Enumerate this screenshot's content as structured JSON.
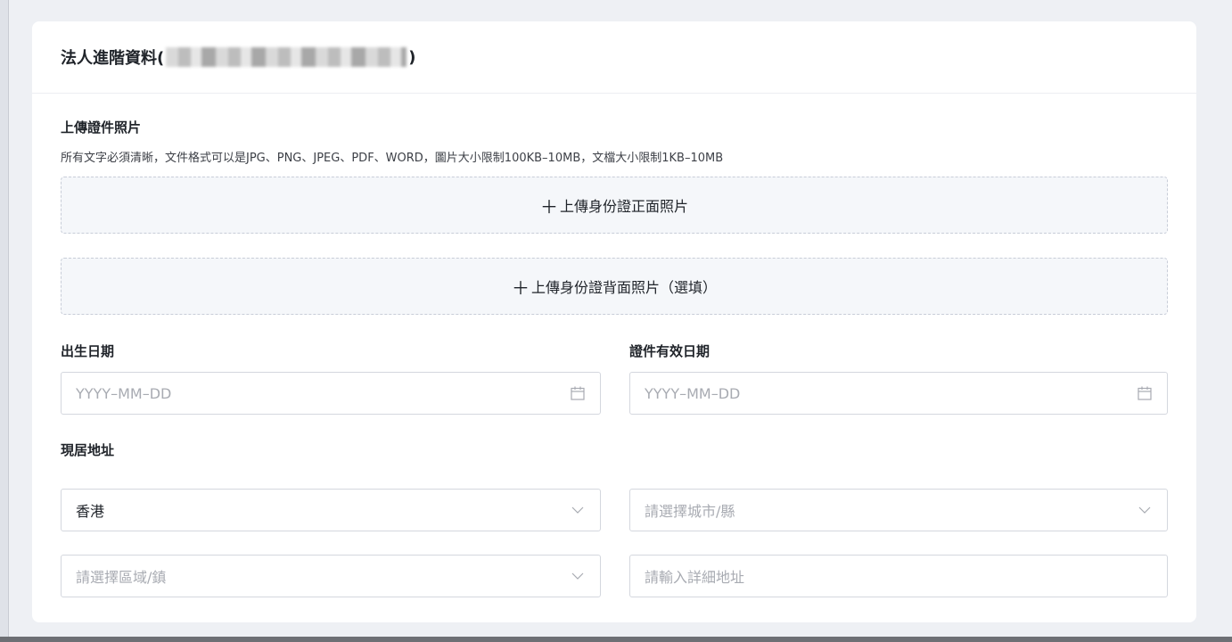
{
  "card": {
    "title_prefix": "法人進階資料(",
    "title_suffix": ")"
  },
  "upload": {
    "section_title": "上傳證件照片",
    "hint": "所有文字必須清晰，文件格式可以是JPG、PNG、JPEG、PDF、WORD，圖片大小限制100KB–10MB，文檔大小限制1KB–10MB",
    "front_label": "上傳身份證正面照片",
    "back_label": "上傳身份證背面照片（選填）",
    "plus": "＋"
  },
  "dates": {
    "birth_label": "出生日期",
    "birth_placeholder": "YYYY–MM–DD",
    "expiry_label": "證件有效日期",
    "expiry_placeholder": "YYYY–MM–DD"
  },
  "address": {
    "label": "現居地址",
    "region_value": "香港",
    "city_placeholder": "請選擇城市/縣",
    "district_placeholder": "請選擇區域/鎮",
    "detail_placeholder": "請輸入詳細地址"
  },
  "icons": {
    "calendar": "calendar-icon",
    "chevron": "chevron-down-icon"
  }
}
